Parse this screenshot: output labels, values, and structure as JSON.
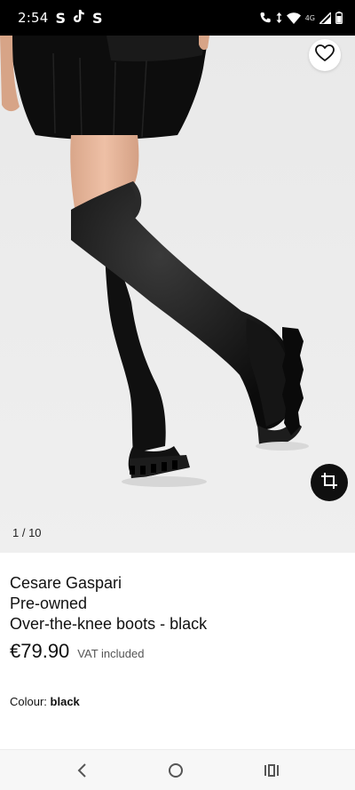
{
  "status_bar": {
    "time": "2:54",
    "app_icons": [
      "S",
      "S"
    ],
    "network_label": "4G"
  },
  "gallery": {
    "pager": "1 / 10"
  },
  "product": {
    "brand": "Cesare Gaspari",
    "condition": "Pre-owned",
    "name": "Over-the-knee boots - black",
    "price": "€79.90",
    "vat_note": "VAT included",
    "colour_label": "Colour:",
    "colour_value": "black"
  },
  "icons": {
    "favorite": "heart-icon",
    "crop": "crop-icon",
    "back": "back-icon",
    "home": "home-icon",
    "recents": "recents-icon"
  }
}
